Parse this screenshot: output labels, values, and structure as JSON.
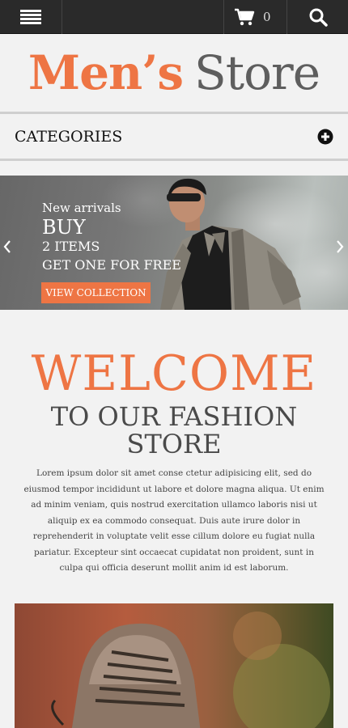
{
  "header": {
    "menu_icon": "hamburger-menu-icon",
    "cart_icon": "shopping-cart-icon",
    "cart_count": "0",
    "search_icon": "search-icon"
  },
  "logo": {
    "part1": "Men’s",
    "part2": "Store"
  },
  "categories": {
    "label": "CATEGORIES",
    "toggle_icon": "plus-circle-icon"
  },
  "hero": {
    "line1": "New arrivals",
    "line2": "BUY",
    "line3": "2 ITEMS",
    "line4": "GET ONE FOR FREE",
    "button": "VIEW COLLECTION",
    "prev_icon": "chevron-left-icon",
    "next_icon": "chevron-right-icon"
  },
  "welcome": {
    "title": "WELCOME",
    "subtitle_line1": "TO OUR FASHION",
    "subtitle_line2": "STORE",
    "text": "Lorem ipsum dolor sit amet conse ctetur adipisicing elit, sed do eiusmod tempor incididunt ut labore et dolore magna aliqua. Ut enim ad minim veniam, quis nostrud exercitation ullamco laboris nisi ut aliquip ex ea commodo consequat. Duis aute irure dolor in reprehenderit in voluptate velit esse cillum dolore eu fugiat nulla pariatur. Excepteur sint occaecat cupidatat non proident, sunt in culpa qui officia deserunt mollit anim id est laborum."
  },
  "colors": {
    "accent": "#ee7544",
    "topbar": "#2a2a2a",
    "background": "#f2f2f2",
    "logo_gray": "#5e5e5e"
  }
}
